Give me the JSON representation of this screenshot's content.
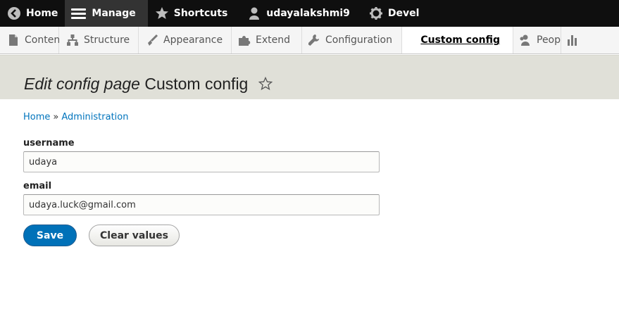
{
  "toolbar": {
    "items": [
      {
        "label": "Home",
        "icon": "back-arrow-icon"
      },
      {
        "label": "Manage",
        "icon": "hamburger-menu-icon",
        "active": true
      },
      {
        "label": "Shortcuts",
        "icon": "star-icon"
      },
      {
        "label": "udayalakshmi9",
        "icon": "user-icon"
      },
      {
        "label": "Devel",
        "icon": "gear-icon"
      }
    ]
  },
  "tray": {
    "items": [
      {
        "label": "Content",
        "icon": "document-icon"
      },
      {
        "label": "Structure",
        "icon": "sitemap-icon"
      },
      {
        "label": "Appearance",
        "icon": "paintbrush-icon"
      },
      {
        "label": "Extend",
        "icon": "puzzle-icon"
      },
      {
        "label": "Configuration",
        "icon": "wrench-icon"
      },
      {
        "label": "Custom config",
        "current": true
      },
      {
        "label": "People",
        "icon": "people-icon"
      }
    ],
    "partial_item_icon": "bar-chart-icon"
  },
  "page": {
    "title_prefix": "Edit config page",
    "title_main": "Custom config",
    "shortcut_icon": "star-outline-icon"
  },
  "breadcrumb": {
    "items": [
      "Home",
      "Administration"
    ],
    "separator": "»"
  },
  "form": {
    "username": {
      "label": "username",
      "value": "udaya"
    },
    "email": {
      "label": "email",
      "value": "udaya.luck@gmail.com"
    },
    "save_label": "Save",
    "clear_label": "Clear values"
  },
  "colors": {
    "toolbar_bg": "#0f0f0f",
    "link": "#0074bd",
    "primary_button": "#0071b8",
    "title_band": "#e0e0d8"
  }
}
